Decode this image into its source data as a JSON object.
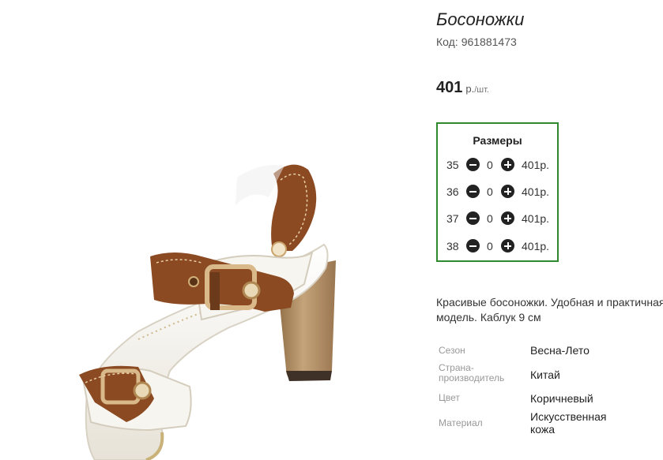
{
  "product": {
    "title": "Босоножки",
    "code_label": "Код:",
    "code_value": "961881473",
    "price": "401",
    "price_unit_rub": "р.",
    "price_unit_pc": "/шт.",
    "image": "sandal-photo"
  },
  "sizes": {
    "title": "Размеры",
    "rows": [
      {
        "size": "35",
        "qty": "0",
        "price": "401р."
      },
      {
        "size": "36",
        "qty": "0",
        "price": "401р."
      },
      {
        "size": "37",
        "qty": "0",
        "price": "401р."
      },
      {
        "size": "38",
        "qty": "0",
        "price": "401р."
      }
    ],
    "minus_icon": "minus-circle-icon",
    "plus_icon": "plus-circle-icon"
  },
  "description": "Красивые босоножки. Удобная и практичная модель. Каблук 9 см",
  "properties": [
    {
      "key": "Сезон",
      "value": "Весна-Лето"
    },
    {
      "key": "Страна-производитель",
      "value": "Китай"
    },
    {
      "key": "Цвет",
      "value": "Коричневый"
    },
    {
      "key": "Материал",
      "value": "Искусственная кожа"
    }
  ],
  "colors": {
    "border_accent": "#2f8a2f",
    "strap_brown": "#8b4a22",
    "leather_white": "#f4f1ea",
    "heel_wood": "#b59467"
  }
}
